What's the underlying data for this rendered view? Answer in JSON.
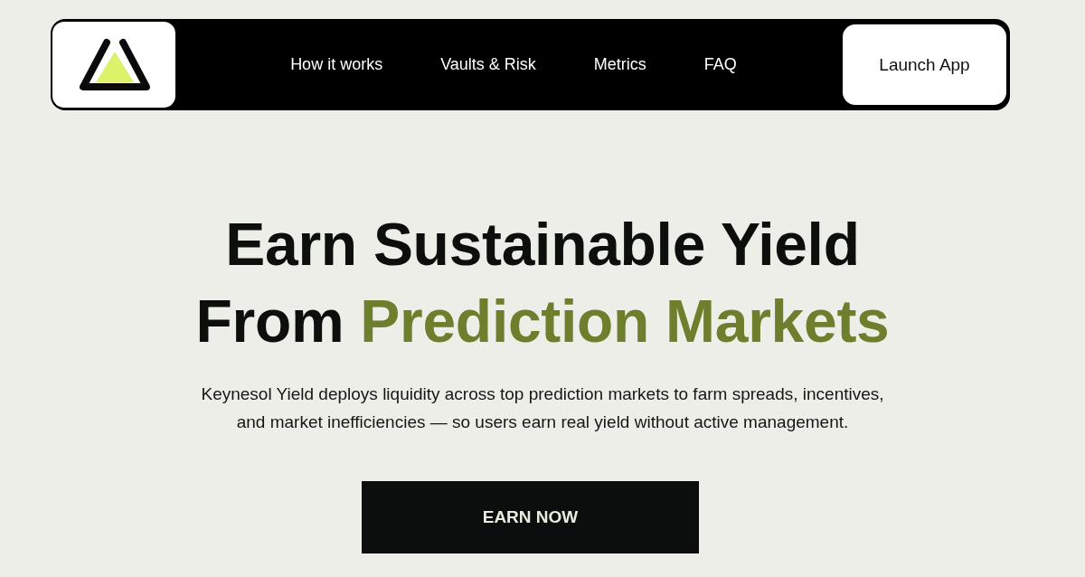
{
  "nav": {
    "links": [
      "How it works",
      "Vaults & Risk",
      "Metrics",
      "FAQ"
    ],
    "button": "Launch App"
  },
  "hero": {
    "title_lines": [
      [
        {
          "text": "Earn Sustainable Yield",
          "accent": false
        }
      ],
      [
        {
          "text": "From",
          "accent": false
        },
        {
          "text": "Prediction Markets",
          "accent": true
        }
      ]
    ],
    "description": "Keynesol Yield deploys liquidity across top prediction markets to farm spreads, incentives, and market inefficiencies — so users earn real yield without active management.",
    "button": "EARN NOW"
  }
}
